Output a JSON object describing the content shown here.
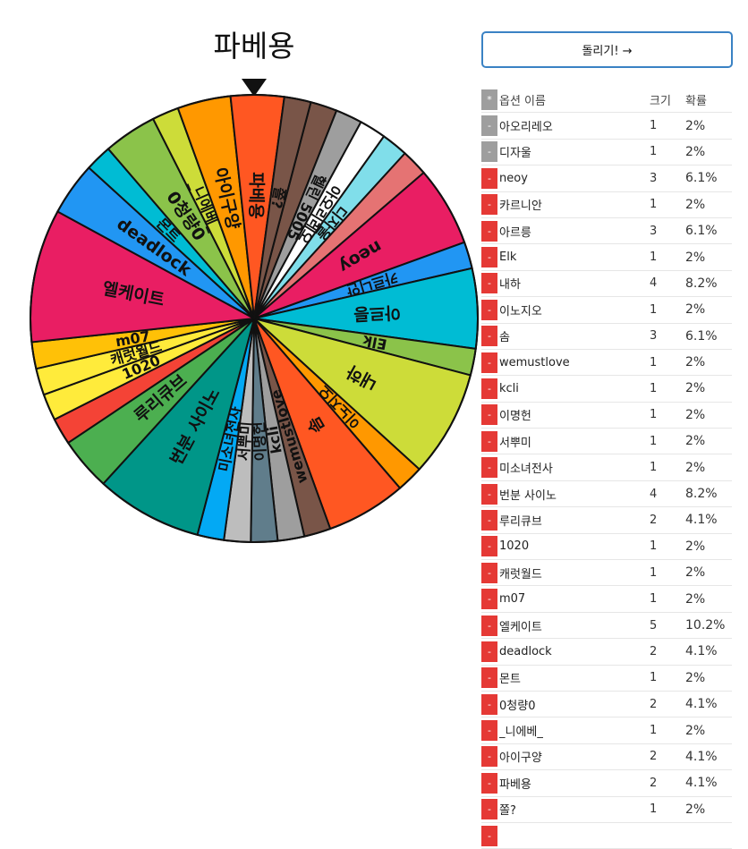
{
  "wheel": {
    "result": "파베용",
    "pointer_icon": "pointer-triangle-icon"
  },
  "controls": {
    "spin_label": "돌리기! →"
  },
  "table": {
    "header": {
      "toggle": "*",
      "name": "옵션 이름",
      "size": "크기",
      "prob": "확률"
    },
    "rows": [
      {
        "toggle": "-",
        "name": "아오리레오",
        "size": "1",
        "prob": "2%",
        "disabled": true
      },
      {
        "toggle": "-",
        "name": "디자울",
        "size": "1",
        "prob": "2%",
        "disabled": true
      },
      {
        "toggle": "-",
        "name": "neoy",
        "size": "3",
        "prob": "6.1%",
        "disabled": false
      },
      {
        "toggle": "-",
        "name": "카르니안",
        "size": "1",
        "prob": "2%",
        "disabled": false
      },
      {
        "toggle": "-",
        "name": "아르릉",
        "size": "3",
        "prob": "6.1%",
        "disabled": false
      },
      {
        "toggle": "-",
        "name": "Elk",
        "size": "1",
        "prob": "2%",
        "disabled": false
      },
      {
        "toggle": "-",
        "name": "내하",
        "size": "4",
        "prob": "8.2%",
        "disabled": false
      },
      {
        "toggle": "-",
        "name": "이노지오",
        "size": "1",
        "prob": "2%",
        "disabled": false
      },
      {
        "toggle": "-",
        "name": "솜",
        "size": "3",
        "prob": "6.1%",
        "disabled": false
      },
      {
        "toggle": "-",
        "name": "wemustlove",
        "size": "1",
        "prob": "2%",
        "disabled": false
      },
      {
        "toggle": "-",
        "name": "kcli",
        "size": "1",
        "prob": "2%",
        "disabled": false
      },
      {
        "toggle": "-",
        "name": "이명헌",
        "size": "1",
        "prob": "2%",
        "disabled": false
      },
      {
        "toggle": "-",
        "name": "서뿌미",
        "size": "1",
        "prob": "2%",
        "disabled": false
      },
      {
        "toggle": "-",
        "name": "미소녀전사",
        "size": "1",
        "prob": "2%",
        "disabled": false
      },
      {
        "toggle": "-",
        "name": "번분 사이노",
        "size": "4",
        "prob": "8.2%",
        "disabled": false
      },
      {
        "toggle": "-",
        "name": "루리큐브",
        "size": "2",
        "prob": "4.1%",
        "disabled": false
      },
      {
        "toggle": "-",
        "name": "1020",
        "size": "1",
        "prob": "2%",
        "disabled": false
      },
      {
        "toggle": "-",
        "name": "캐럿월드",
        "size": "1",
        "prob": "2%",
        "disabled": false
      },
      {
        "toggle": "-",
        "name": "m07",
        "size": "1",
        "prob": "2%",
        "disabled": false
      },
      {
        "toggle": "-",
        "name": "엘케이트",
        "size": "5",
        "prob": "10.2%",
        "disabled": false
      },
      {
        "toggle": "-",
        "name": "deadlock",
        "size": "2",
        "prob": "4.1%",
        "disabled": false
      },
      {
        "toggle": "-",
        "name": "몬트",
        "size": "1",
        "prob": "2%",
        "disabled": false
      },
      {
        "toggle": "-",
        "name": "0청량0",
        "size": "2",
        "prob": "4.1%",
        "disabled": false
      },
      {
        "toggle": "-",
        "name": "_니에베_",
        "size": "1",
        "prob": "2%",
        "disabled": false
      },
      {
        "toggle": "-",
        "name": "아이구양",
        "size": "2",
        "prob": "4.1%",
        "disabled": false
      },
      {
        "toggle": "-",
        "name": "파베용",
        "size": "2",
        "prob": "4.1%",
        "disabled": false
      },
      {
        "toggle": "-",
        "name": "쫄?",
        "size": "1",
        "prob": "2%",
        "disabled": false
      },
      {
        "toggle": "-",
        "name": "",
        "size": "",
        "prob": "",
        "disabled": false
      }
    ]
  },
  "slices": [
    {
      "label": "",
      "weight": 1,
      "color": "#795548"
    },
    {
      "label": "헬린 5005",
      "weight": 1,
      "color": "#9e9e9e"
    },
    {
      "label": "아오리레오",
      "weight": 1,
      "color": "#ffffff"
    },
    {
      "label": "디자울",
      "weight": 1,
      "color": "#80deea"
    },
    {
      "label": "",
      "weight": 1,
      "color": "#e57373"
    },
    {
      "label": "neoy",
      "weight": 3,
      "color": "#e91e63"
    },
    {
      "label": "카르니안",
      "weight": 1,
      "color": "#2196f3"
    },
    {
      "label": "아르릉",
      "weight": 3,
      "color": "#00bcd4"
    },
    {
      "label": "Elk",
      "weight": 1,
      "color": "#8bc34a"
    },
    {
      "label": "내하",
      "weight": 4,
      "color": "#cddc39"
    },
    {
      "label": "이노지오",
      "weight": 1,
      "color": "#ff9800"
    },
    {
      "label": "솜",
      "weight": 3,
      "color": "#ff5722"
    },
    {
      "label": "wemustlove",
      "weight": 1,
      "color": "#795548"
    },
    {
      "label": "kcli",
      "weight": 1,
      "color": "#9e9e9e"
    },
    {
      "label": "이명헌",
      "weight": 1,
      "color": "#607d8b"
    },
    {
      "label": "서뿌미",
      "weight": 1,
      "color": "#bdbdbd"
    },
    {
      "label": "미소녀전사",
      "weight": 1,
      "color": "#03a9f4"
    },
    {
      "label": "번분 사이노",
      "weight": 4,
      "color": "#009688"
    },
    {
      "label": "루리큐브",
      "weight": 2,
      "color": "#4caf50"
    },
    {
      "label": "",
      "weight": 1,
      "color": "#f44336"
    },
    {
      "label": "1020",
      "weight": 1,
      "color": "#ffeb3b"
    },
    {
      "label": "캐럿월드",
      "weight": 1,
      "color": "#ffeb3b"
    },
    {
      "label": "m07",
      "weight": 1,
      "color": "#ffc107"
    },
    {
      "label": "엘케이트",
      "weight": 5,
      "color": "#e91e63"
    },
    {
      "label": "deadlock",
      "weight": 2,
      "color": "#2196f3"
    },
    {
      "label": "몬트",
      "weight": 1,
      "color": "#00bcd4"
    },
    {
      "label": "0청량0",
      "weight": 2,
      "color": "#8bc34a"
    },
    {
      "label": "_니에베_",
      "weight": 1,
      "color": "#cddc39"
    },
    {
      "label": "아이구양",
      "weight": 2,
      "color": "#ff9800"
    },
    {
      "label": "파베용",
      "weight": 2,
      "color": "#ff5722"
    },
    {
      "label": "쫄?",
      "weight": 1,
      "color": "#795548"
    }
  ]
}
